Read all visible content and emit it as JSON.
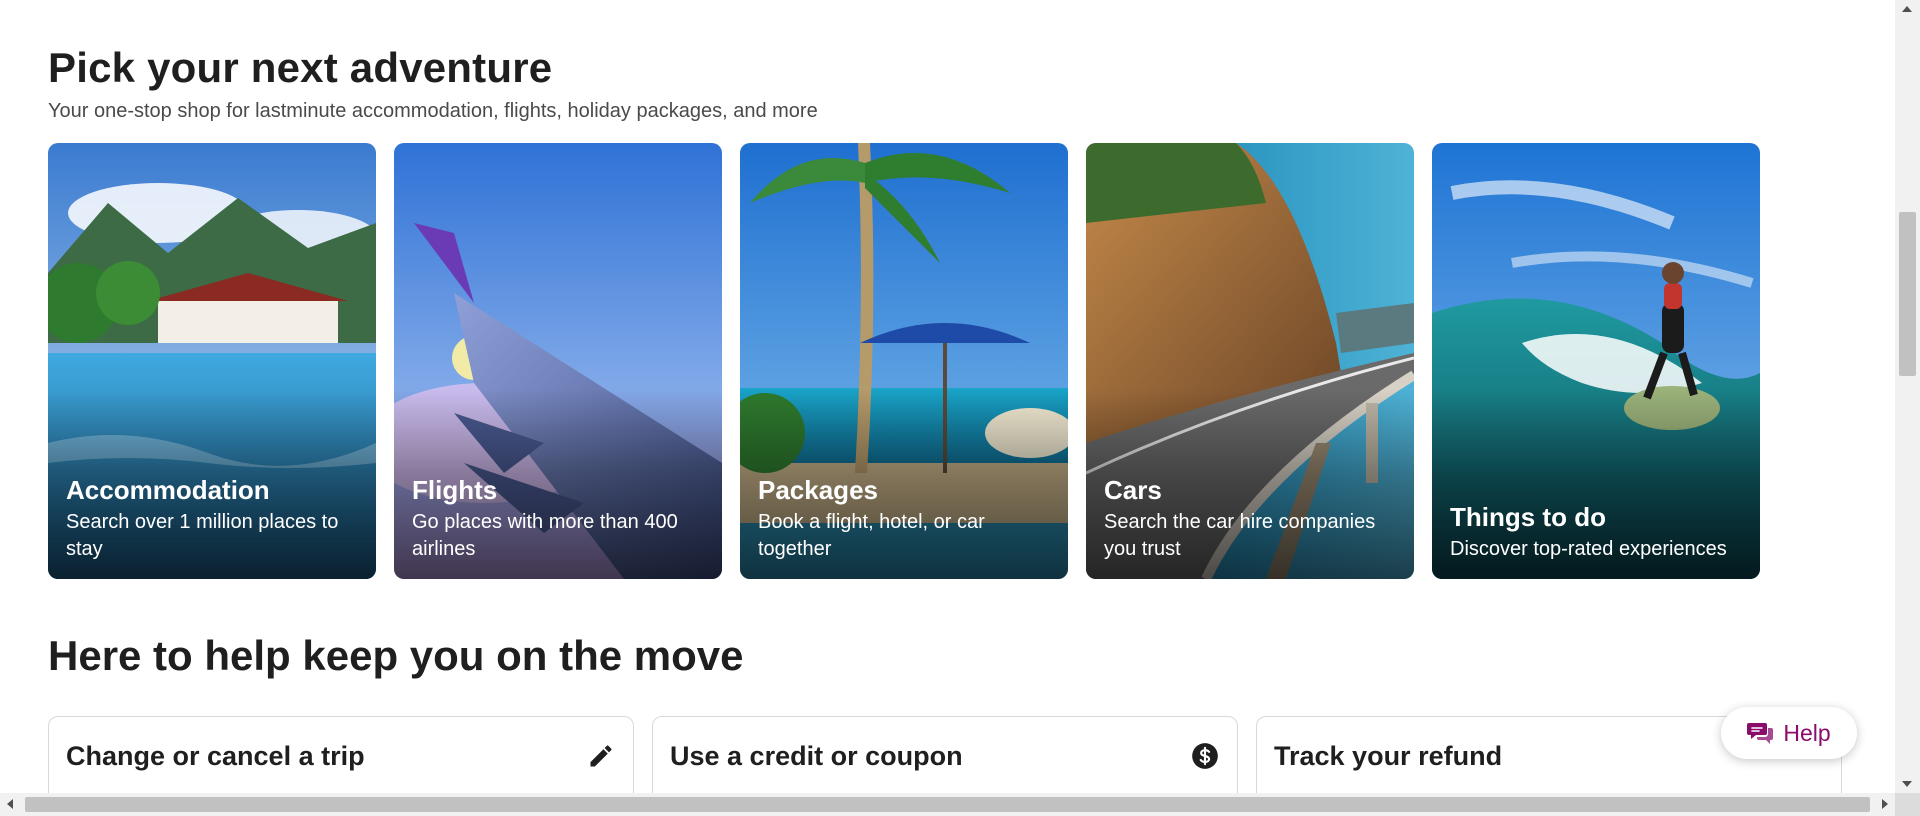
{
  "section1": {
    "title": "Pick your next adventure",
    "subtitle": "Your one-stop shop for lastminute accommodation, flights, holiday packages, and more"
  },
  "cards": [
    {
      "title": "Accommodation",
      "description": "Search over 1 million places to stay",
      "image": "resort-pool-photo"
    },
    {
      "title": "Flights",
      "description": "Go places with more than 400 airlines",
      "image": "airplane-wing-photo"
    },
    {
      "title": "Packages",
      "description": "Book a flight, hotel, or car together",
      "image": "beach-palm-umbrella-photo"
    },
    {
      "title": "Cars",
      "description": "Search the car hire companies you trust",
      "image": "coastal-bridge-road-photo"
    },
    {
      "title": "Things to do",
      "description": "Discover top-rated experiences",
      "image": "surfer-wave-photo"
    }
  ],
  "section2": {
    "title": "Here to help keep you on the move"
  },
  "help_cards": [
    {
      "label": "Change or cancel a trip",
      "icon": "pencil-icon"
    },
    {
      "label": "Use a credit or coupon",
      "icon": "coupon-dollar-icon"
    },
    {
      "label": "Track your refund",
      "icon": ""
    }
  ],
  "help_button": {
    "label": "Help",
    "icon": "chat-icon",
    "color": "#8a0d6b"
  }
}
